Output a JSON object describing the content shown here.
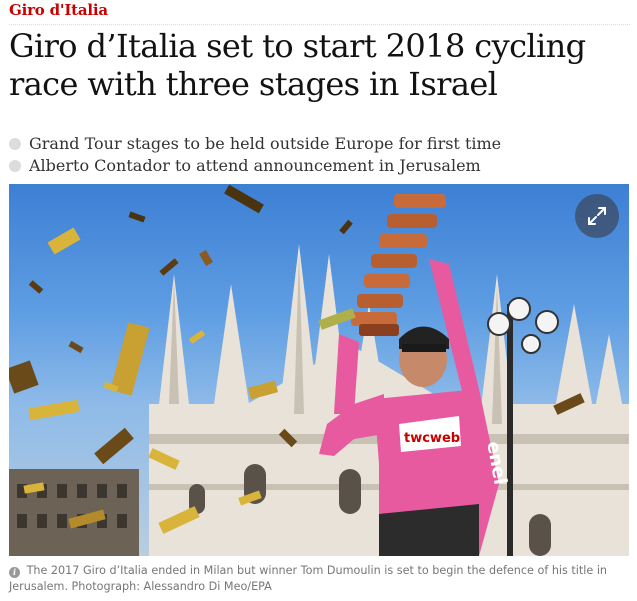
{
  "section": {
    "label": "Giro d'Italia"
  },
  "article": {
    "headline": "Giro d’Italia set to start 2018 cycling race with three stages in Israel",
    "standfirst": [
      "Grand Tour stages to be held outside Europe for first time",
      "Alberto Contador to attend announcement in Jerusalem"
    ]
  },
  "image": {
    "expand_icon": "expand-arrows-icon",
    "jersey_text": "twcweb",
    "jersey_brand": "enel",
    "caption": "The 2017 Giro d’Italia ended in Milan but winner Tom Dumoulin is set to begin the defence of his title in Jerusalem. Photograph: Alessandro Di Meo/EPA",
    "info_icon": "i"
  },
  "colors": {
    "section_red": "#c70000",
    "headline": "#121212",
    "caption_grey": "#767676",
    "bullet_grey": "#dcdcdc",
    "jersey_pink": "#e85aa0"
  }
}
